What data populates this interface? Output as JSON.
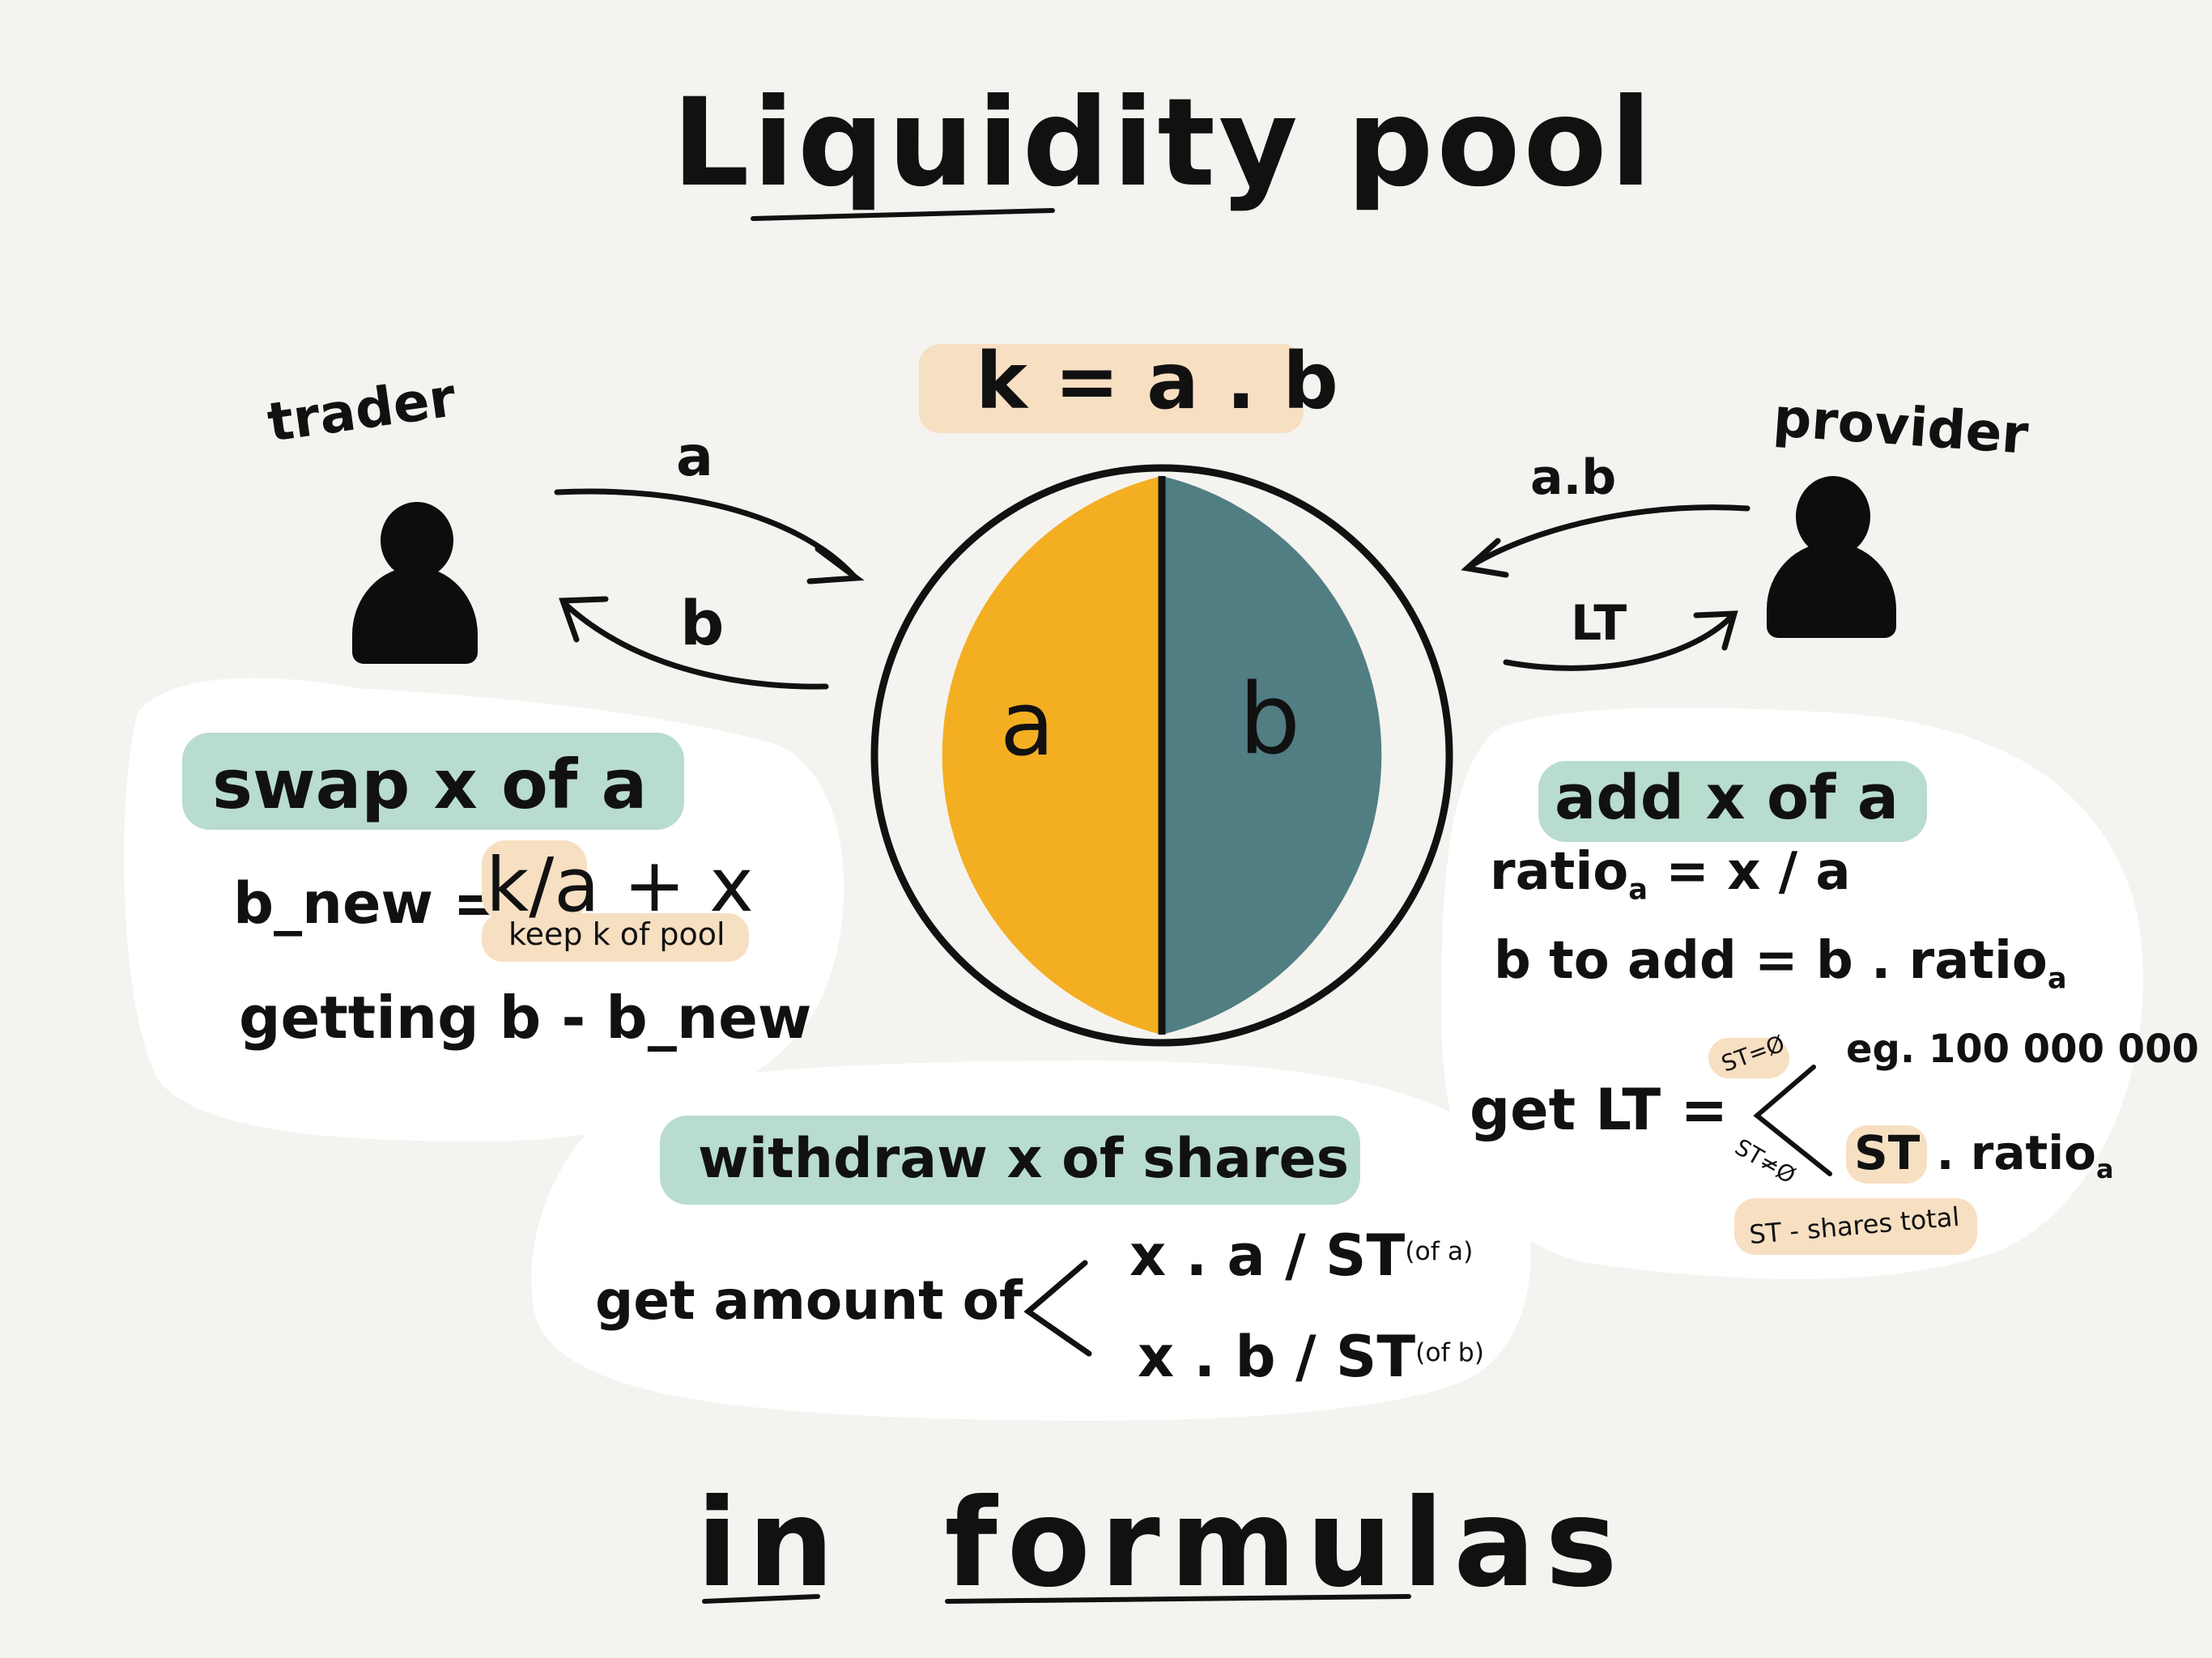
{
  "title": "Liquidity pool",
  "footer": "in formulas",
  "formula_k": "k = a . b",
  "colors": {
    "pool_a": "#f4ae22",
    "pool_b": "#507e82",
    "highlight_green": "#b8dccd",
    "highlight_peach": "#f7dfc2",
    "background": "#f4f3ef"
  },
  "pool": {
    "left_label": "a",
    "right_label": "b"
  },
  "trader": {
    "label": "trader",
    "arrow_to_pool": "a",
    "arrow_from_pool": "b"
  },
  "provider": {
    "label": "provider",
    "arrow_to_pool": "a.b",
    "arrow_from_pool": "LT"
  },
  "swap_box": {
    "heading": "swap x of a",
    "line1_left": "b_new =",
    "line1_expr": "k/a + x",
    "note": "keep k of pool",
    "line2": "getting  b - b_new"
  },
  "add_box": {
    "heading": "add x of a",
    "ratio_word": "ratio",
    "ratio_sub": "a",
    "ratio_rhs": "= x / a",
    "b_to_add": "b to add = b . ratio",
    "b_to_add_sub": "a",
    "get_lt": "get LT =",
    "case1_cond": "ST=Ø",
    "case1_value": "eg. 100 000 000",
    "case2_cond": "ST≠Ø",
    "case2_value_st": "ST",
    "case2_value_rest": ". ratio",
    "case2_value_sub": "a",
    "st_note": "ST - shares total"
  },
  "withdraw_box": {
    "heading": "withdraw x of shares",
    "lead": "get amount of",
    "case1": "x . a / ST",
    "case1_note": "(of a)",
    "case2": "x . b / ST",
    "case2_note": "(of b)"
  }
}
